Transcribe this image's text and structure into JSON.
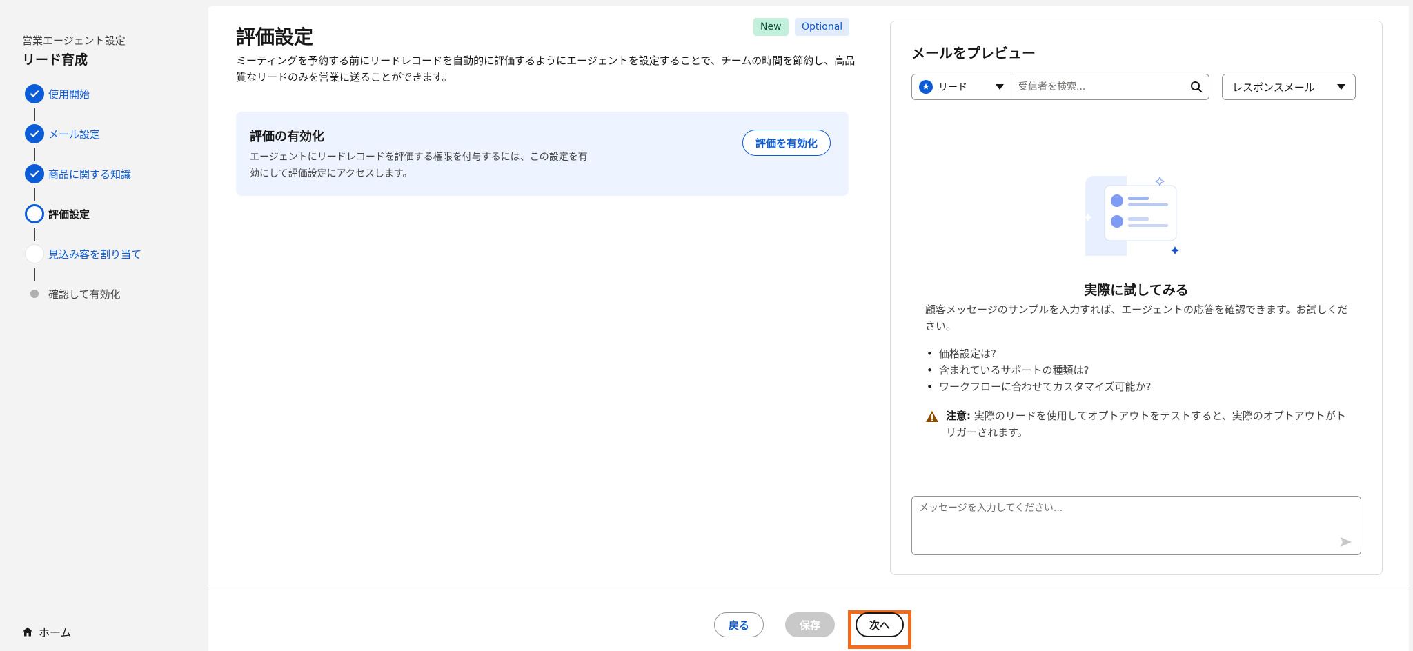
{
  "sidebar": {
    "caption": "営業エージェント設定",
    "title": "リード育成",
    "steps": [
      {
        "label": "使用開始",
        "state": "done"
      },
      {
        "label": "メール設定",
        "state": "done"
      },
      {
        "label": "商品に関する知識",
        "state": "done"
      },
      {
        "label": "評価設定",
        "state": "current"
      },
      {
        "label": "見込み客を割り当て",
        "state": "pending"
      },
      {
        "label": "確認して有効化",
        "state": "upcoming"
      }
    ],
    "home_label": "ホーム"
  },
  "header": {
    "title": "評価設定",
    "badges": [
      "New",
      "Optional"
    ],
    "description": "ミーティングを予約する前にリードレコードを自動的に評価するようにエージェントを設定することで、チームの時間を節約し、高品質なリードのみを営業に送ることができます。"
  },
  "enable_card": {
    "title": "評価の有効化",
    "description": "エージェントにリードレコードを評価する権限を付与するには、この設定を有効にして評価設定にアクセスします。",
    "button_label": "評価を有効化"
  },
  "preview": {
    "title": "メールをプレビュー",
    "record_type": "リード",
    "search_placeholder": "受信者を検索...",
    "mail_type": "レスポンスメール",
    "try_title": "実際に試してみる",
    "try_description": "顧客メッセージのサンプルを入力すれば、エージェントの応答を確認できます。お試しください。",
    "examples": [
      "価格設定は?",
      "含まれているサポートの種類は?",
      "ワークフローに合わせてカスタマイズ可能か?"
    ],
    "note_label": "注意:",
    "note_text": "実際のリードを使用してオプトアウトをテストすると、実際のオプトアウトがトリガーされます。",
    "message_placeholder": "メッセージを入力してください..."
  },
  "footer": {
    "back_label": "戻る",
    "save_label": "保存",
    "next_label": "次へ"
  },
  "colors": {
    "brand": "#0b5cd6",
    "highlight": "#f26a1b",
    "card_bg": "#eef4ff",
    "new_badge": "#c3f0dc"
  }
}
